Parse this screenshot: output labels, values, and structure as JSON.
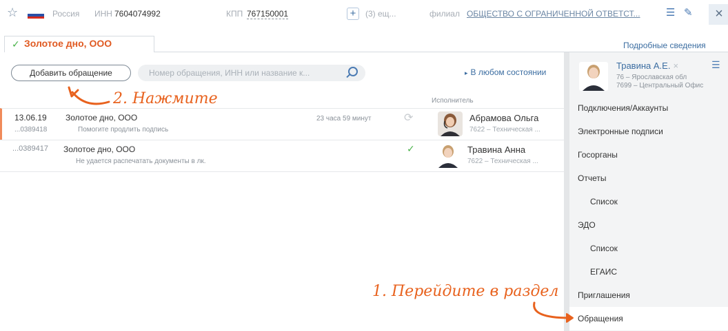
{
  "topbar": {
    "country": "Россия",
    "inn_label": "ИНН",
    "inn_value": "7604074992",
    "kpp_label": "КПП",
    "kpp_value": "767150001",
    "plus_label": "+",
    "more_label": "(3)  ещ...",
    "filial_label": "филиал",
    "filial_value": "ОБЩЕСТВО С ОГРАНИЧЕННОЙ ОТВЕТСТ...",
    "close_label": "×",
    "icons": [
      "star-icon",
      "filter-lines-icon",
      "pen-icon",
      "close-icon"
    ]
  },
  "tab": {
    "label": "Золотое дно, ООО",
    "check": "✓",
    "details_link": "Подробные сведения"
  },
  "toolbar": {
    "add_button": "Добавить обращение",
    "search_placeholder": "Номер обращения, ИНН или название к...",
    "state_filter": "В любом состоянии",
    "state_triangle": "▸"
  },
  "table": {
    "executor_header": "Исполнитель",
    "rows": [
      {
        "date": "13.06.19",
        "number": "...0389418",
        "client": "Золотое дно, ООО",
        "description": "Помогите продлить подпись",
        "time_left": "23 часа 59 минут",
        "executor": "Абрамова Ольга",
        "department": "7622 – Техническая ...",
        "status_icon": "refresh-icon"
      },
      {
        "date": "",
        "number": "...0389417",
        "client": "Золотое дно, ООО",
        "description": "Не удается распечатать документы в лк.",
        "time_left": "",
        "executor": "Травина Анна",
        "department": "7622 – Техническая ...",
        "status_icon": "checkmark-icon"
      }
    ]
  },
  "annotations": {
    "hint_press": "2. Нажмите",
    "hint_go": "1. Перейдите в раздел"
  },
  "profile": {
    "name": "Травина А.Е.",
    "close": "×",
    "region": "76 – Ярославская обл",
    "office": "7699 – Центральный Офис",
    "menu_icon": "☰"
  },
  "menu": {
    "items": [
      "Подключения/Аккаунты",
      "Электронные подписи",
      "Госорганы",
      "Отчеты",
      "Список",
      "ЭДО",
      "Список",
      "ЕГАИС",
      "Приглашения",
      "Обращения"
    ],
    "active": "Обращения"
  },
  "colors": {
    "accent_orange": "#e8621e",
    "link_blue": "#3b6da1",
    "success_green": "#4ab34a"
  }
}
